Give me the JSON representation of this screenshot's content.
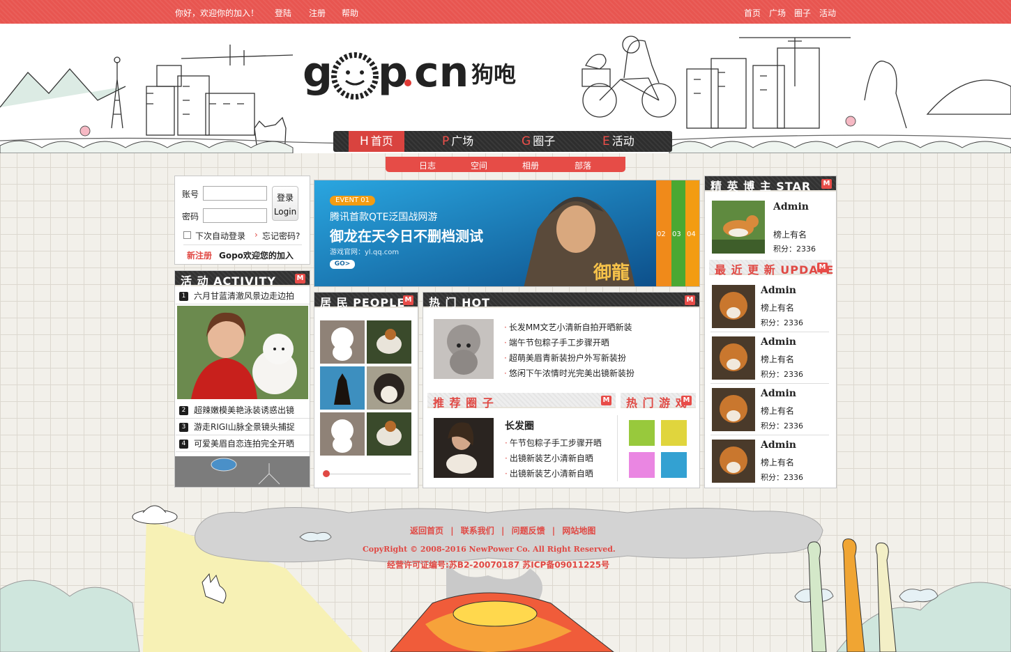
{
  "topbar": {
    "greeting": "你好，欢迎你的加入！",
    "login": "登陆",
    "register": "注册",
    "help": "帮助",
    "right_links": [
      "首页",
      "广场",
      "圈子",
      "活动"
    ]
  },
  "logo": {
    "text": "gop.cn",
    "cn": "狗咆"
  },
  "mainnav": [
    {
      "key": "H",
      "label": "首页",
      "active": true
    },
    {
      "key": "P",
      "label": "广场"
    },
    {
      "key": "G",
      "label": "圈子"
    },
    {
      "key": "E",
      "label": "活动"
    }
  ],
  "subnav": [
    "日志",
    "空间",
    "相册",
    "部落"
  ],
  "login": {
    "account_label": "账号",
    "password_label": "密码",
    "btn_cn": "登录",
    "btn_en": "Login",
    "auto_login": "下次自动登录",
    "forgot": "忘记密码?",
    "register": "新注册",
    "welcome": "Gopo欢迎您的加入"
  },
  "activity": {
    "title": "活 动 ACTIVITY",
    "items": [
      "六月甘蓝清澈风景边走边拍",
      "超辣嫩模美艳泳装诱惑出镜",
      "游走RIGI山脉全景镜头捕捉",
      "可爱美眉自恋连拍完全开晒"
    ],
    "numbers": [
      "1",
      "2",
      "3",
      "4"
    ]
  },
  "banner": {
    "event": "EVENT 01",
    "line1": "腾讯首款QTE泛国战网游",
    "line2": "御龙在天今日不删档测试",
    "site": "游戏官网：yl.qq.com",
    "go": "GO>",
    "tabs": [
      "02",
      "03",
      "04"
    ],
    "game_logo": "御龍"
  },
  "people": {
    "title": "居 民 PEOPLE"
  },
  "hot": {
    "title": "热 门 HOT",
    "items": [
      "长发MM文艺小清新自拍开晒新装",
      "端午节包粽子手工步骤开晒",
      "超萌美眉青新装扮户外写新装扮",
      "悠闲下午浓情时光完美出镜新装扮"
    ]
  },
  "circle": {
    "title": "推 荐 圈 子",
    "name": "长发圈",
    "items": [
      "午节包粽子手工步骤开晒",
      "出镜新装艺小清新自晒",
      "出镜新装艺小清新自晒"
    ]
  },
  "games": {
    "title": "热 门 游 戏",
    "colors": [
      "#98c93c",
      "#e0d53d",
      "#ea86e2",
      "#33a1d2"
    ]
  },
  "star": {
    "title": "精 英 博 主 STAR",
    "name": "Admin",
    "rank": "榜上有名",
    "score": "积分：2336"
  },
  "update": {
    "title": "最 近 更 新 UPDATE",
    "items": [
      {
        "name": "Admin",
        "rank": "榜上有名",
        "score": "积分：2336"
      },
      {
        "name": "Admin",
        "rank": "榜上有名",
        "score": "积分：2336"
      },
      {
        "name": "Admin",
        "rank": "榜上有名",
        "score": "积分：2336"
      },
      {
        "name": "Admin",
        "rank": "榜上有名",
        "score": "积分：2336"
      }
    ]
  },
  "footer": {
    "links": [
      "返回首页",
      "联系我们",
      "问题反馈",
      "网站地图"
    ],
    "sep": "|",
    "copyright": "CopyRight © 2008-2016 NewPower Co. All Right Reserved.",
    "license": "经营许可证编号:苏B2-20070187 苏ICP备09011225号"
  },
  "colors": {
    "brand_red": "#e85550",
    "dark": "#323232"
  }
}
